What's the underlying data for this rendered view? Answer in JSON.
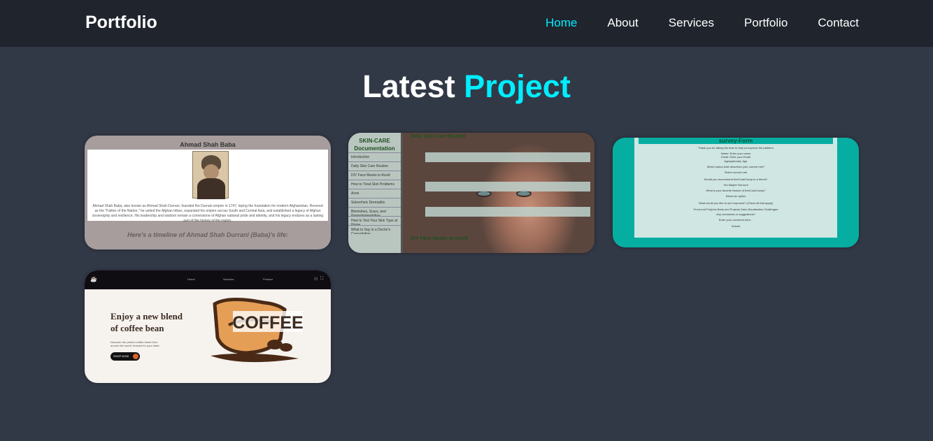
{
  "nav": {
    "logo": "Portfolio",
    "links": [
      "Home",
      "About",
      "Services",
      "Portfolio",
      "Contact"
    ],
    "active": "Home"
  },
  "section": {
    "title_main": "Latest",
    "title_accent": "Project"
  },
  "colors": {
    "background": "#323946",
    "navbar": "#1f242d",
    "accent": "#00eeff"
  },
  "projects": [
    {
      "name": "ahmad-shah-baba",
      "heading": "Ahmad Shah Baba",
      "paragraph": "Ahmad Shah Baba, also known as Ahmad Shah Durrani, founded the Durrani empire in 1747, laying the foundation for modern Afghanistan. Revered as the \"Father of the Nation,\" he united the Afghan tribes, expanded his empire across South and Central Asia, and established a legacy of Afghan sovereignty and resilience. His leadership and wisdom remain a cornerstone of Afghan national pride and identity, and his legacy endures as a lasting part of the history of the region.",
      "timeline": "Here's a timeline of Ahmad Shah Durrani (Baba)'s life:"
    },
    {
      "name": "skin-care-documentation",
      "sidebar_title": "SKIN-CARE Documentation",
      "sidebar_items": [
        "Introduction",
        "Daily Skin Care Routine",
        "DIY Face Masks to Avoid",
        "How to Treat Skin Problems",
        "Acne",
        "Seborrheic Dermatitis",
        "Blemishes, Scars, and Hyperpigmentation",
        "How to Test Your Skin Type at Home",
        "What to Say in a Doctor's Consultation"
      ],
      "heading": "Daily Skin Care Routine",
      "subheading": "DIY Face Masks to Avoid"
    },
    {
      "name": "survey-form",
      "heading": "survey-Form",
      "lines": [
        "Thank you for taking the time to help us improve the platform",
        "Name: Enter your name",
        "Email: Enter your Email",
        "Age(optional): Age",
        "Which option best describes your current role?",
        "Select current role",
        "Would you recommend freeCodeCamp to a friend?",
        "Yes   Maybe   Not sure",
        "What is your favorite feature of freeCodeCamp?",
        "Select an option",
        "What would you like to see improved? (Check all that apply)",
        "Front-end Projects   Back-end Projects   Data Visualization   Challenges",
        "Any comments or suggestions?",
        "Enter your comment here...",
        "Submit"
      ]
    },
    {
      "name": "coffee-landing",
      "nav_links": [
        "Home",
        "Services",
        "Product"
      ],
      "headline_line1": "Enjoy a new blend",
      "headline_line2": "of coffee bean",
      "sub": "Discover the perfect coffee blend from around the world, brewed for your taste.",
      "button": "SHOP NOW",
      "logo_text": "COFFEE"
    }
  ]
}
